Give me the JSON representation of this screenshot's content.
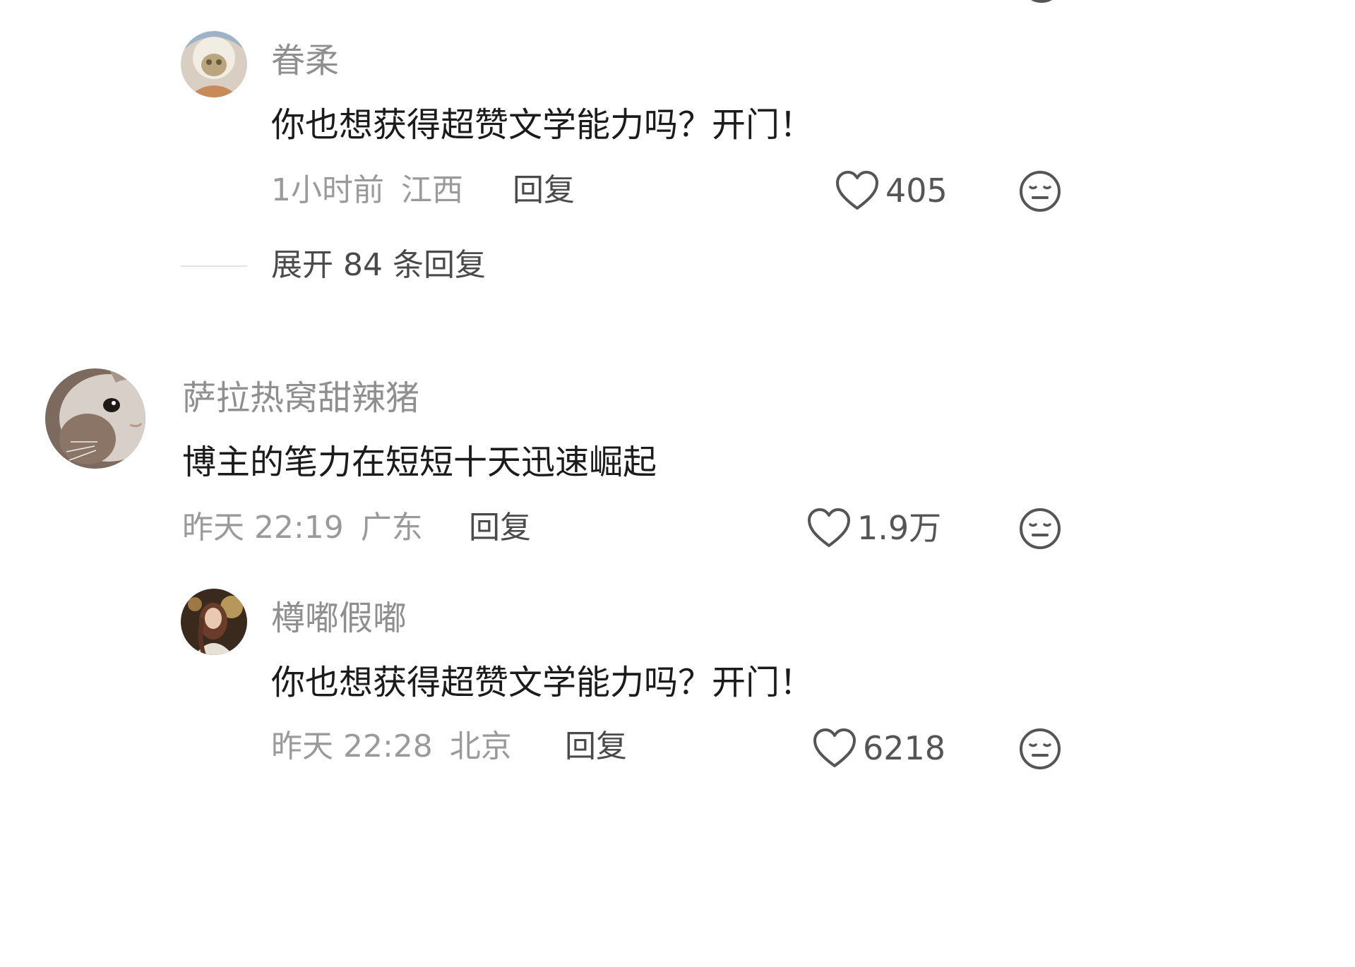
{
  "top_cut": {
    "icon": "dislike-face-icon"
  },
  "comments": [
    {
      "username": "眷柔",
      "text": "你也想获得超赞文学能力吗？开门！",
      "time": "1小时前",
      "location": "江西",
      "reply_label": "回复",
      "like_count": "405",
      "is_reply": true
    },
    {
      "username": "萨拉热窝甜辣猪",
      "text": "博主的笔力在短短十天迅速崛起",
      "time": "昨天 22:19",
      "location": "广东",
      "reply_label": "回复",
      "like_count": "1.9万",
      "is_reply": false
    },
    {
      "username": "樽嘟假嘟",
      "text": "你也想获得超赞文学能力吗？开门！",
      "time": "昨天 22:28",
      "location": "北京",
      "reply_label": "回复",
      "like_count": "6218",
      "is_reply": true
    }
  ],
  "expand_replies": {
    "label": "展开 84 条回复"
  },
  "icons": {
    "like": "heart-icon",
    "dislike": "dislike-face-icon"
  },
  "colors": {
    "username": "#8f8f8f",
    "content": "#1b1b1b",
    "meta": "#9a9a9a",
    "action": "#4a4a4a"
  }
}
